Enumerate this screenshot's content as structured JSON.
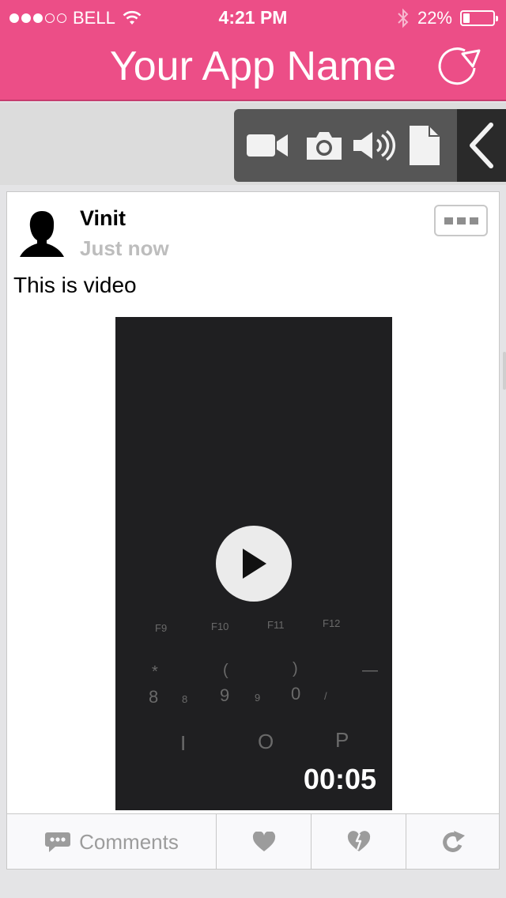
{
  "status_bar": {
    "carrier": "BELL",
    "time": "4:21 PM",
    "battery": "22%",
    "battery_level": 0.22,
    "signal_bars_filled": 3,
    "signal_bars_total": 5
  },
  "header": {
    "title": "Your App Name",
    "background": "#ec4e87"
  },
  "toolbar": {
    "icons": [
      "video-camera-icon",
      "camera-icon",
      "speaker-icon",
      "document-icon",
      "chevron-left-icon"
    ]
  },
  "post": {
    "username": "Vinit",
    "timestamp": "Just now",
    "text": "This is video",
    "video": {
      "duration": "00:05",
      "keyboard_labels": {
        "f9": "F9",
        "f10": "F10",
        "f11": "F11",
        "f12": "F12",
        "star": "*",
        "lparen": "(",
        "rparen": ")",
        "dash": "—",
        "k8": "8",
        "k8s": "8",
        "k9": "9",
        "k9s": "9",
        "k0": "0",
        "slash": "/",
        "i": "I",
        "o": "O",
        "p": "P"
      }
    }
  },
  "actions": {
    "comments_label": "Comments"
  }
}
